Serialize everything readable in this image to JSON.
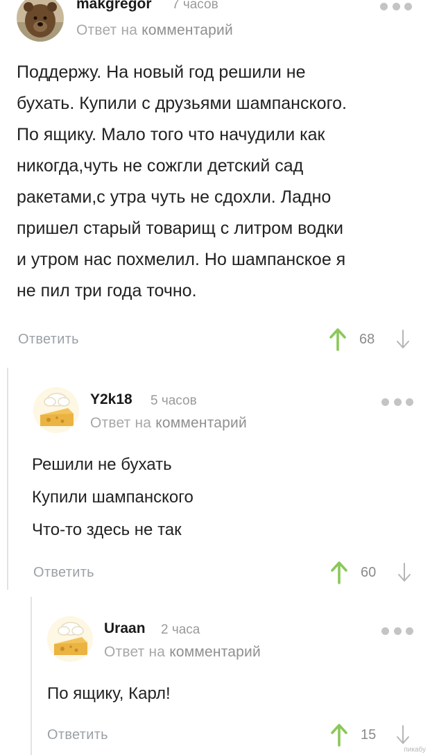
{
  "comments": [
    {
      "username": "makgregor",
      "time": "7 часов",
      "reply_prefix": "Ответ на",
      "reply_link": "комментарий",
      "lines": [
        "Поддержу. На новый год решили не",
        "бухать. Купили с друзьями шампанского.",
        "По ящику. Мало того что начудили как",
        "никогда,чуть не сожгли детский сад",
        "ракетами,с утра чуть не сдохли. Ладно",
        "пришел старый товарищ с литром водки",
        "и утром нас похмелил. Но шампанское я",
        "не пил три года точно."
      ],
      "reply_label": "Ответить",
      "score": "68",
      "avatar_icon": "bear-avatar"
    },
    {
      "username": "Y2k18",
      "time": "5 часов",
      "reply_prefix": "Ответ на",
      "reply_link": "комментарий",
      "lines": [
        "Решили не бухать",
        "Купили шампанского",
        "Что-то здесь не так"
      ],
      "reply_label": "Ответить",
      "score": "60",
      "avatar_icon": "chef-cheese-avatar"
    },
    {
      "username": "Uraan",
      "time": "2 часа",
      "reply_prefix": "Ответ на",
      "reply_link": "комментарий",
      "lines": [
        "По ящику, Карл!"
      ],
      "reply_label": "Ответить",
      "score": "15",
      "avatar_icon": "chef-cheese-avatar"
    }
  ],
  "watermark": "пикабу",
  "colors": {
    "upvote": "#8ac858",
    "downvote": "#b5b5b5",
    "muted": "#a7a7a7"
  }
}
